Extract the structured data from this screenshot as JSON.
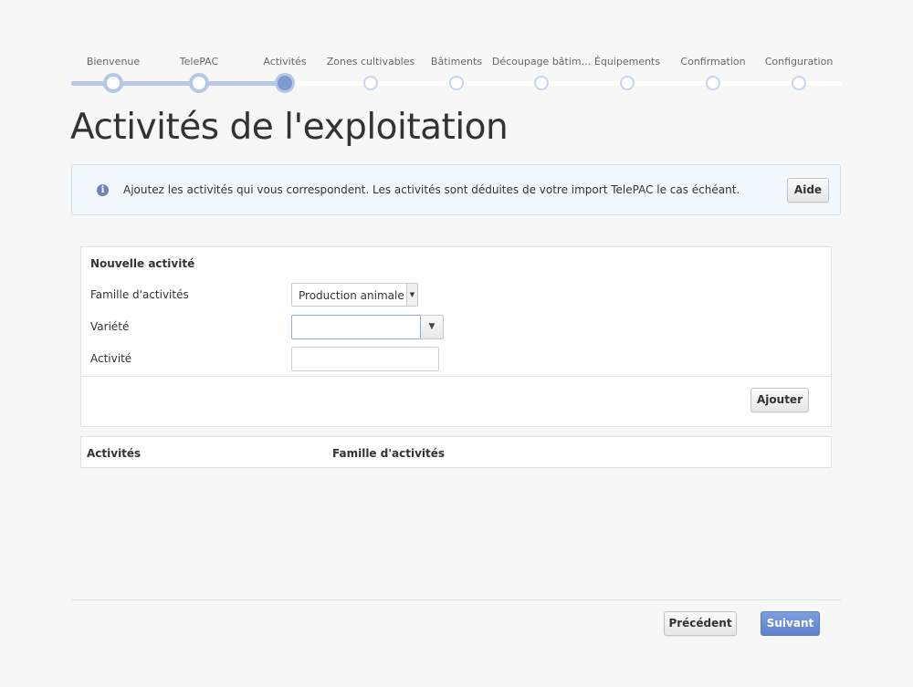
{
  "stepper": {
    "steps": [
      {
        "label": "Bienvenue",
        "state": "done"
      },
      {
        "label": "TelePAC",
        "state": "done"
      },
      {
        "label": "Activités",
        "state": "current"
      },
      {
        "label": "Zones cultivables",
        "state": "future"
      },
      {
        "label": "Bâtiments",
        "state": "future"
      },
      {
        "label": "Découpage bâtim...",
        "state": "future"
      },
      {
        "label": "Équipements",
        "state": "future"
      },
      {
        "label": "Confirmation",
        "state": "future"
      },
      {
        "label": "Configuration",
        "state": "future"
      }
    ],
    "colors": {
      "done": "#b5c7e6",
      "current": "#7d9ad2",
      "future": "#c7d6ee"
    }
  },
  "page": {
    "title": "Activités de l'exploitation"
  },
  "info": {
    "icon": "info-icon",
    "text": "Ajoutez les activités qui vous correspondent. Les activités sont déduites de votre import TelePAC le cas échéant.",
    "help_button": "Aide"
  },
  "form": {
    "heading": "Nouvelle activité",
    "family_label": "Famille d'activités",
    "family_value": "Production animale",
    "variety_label": "Variété",
    "variety_value": "",
    "activity_label": "Activité",
    "activity_value": "",
    "add_button": "Ajouter"
  },
  "table": {
    "columns": [
      "Activités",
      "Famille d'activités"
    ]
  },
  "footer": {
    "prev_button": "Précédent",
    "next_button": "Suivant",
    "accent": "#6a8cd6"
  }
}
